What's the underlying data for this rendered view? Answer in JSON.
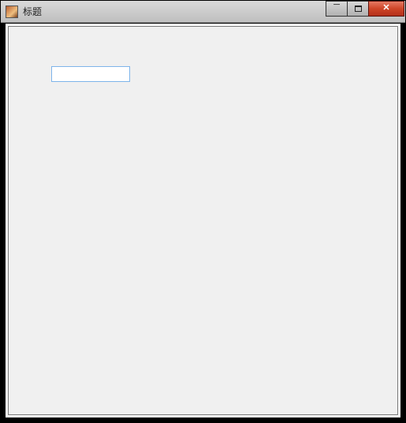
{
  "window": {
    "title": "标题"
  },
  "input": {
    "value": "",
    "placeholder": ""
  },
  "icons": {
    "minimize": "minimize-icon",
    "maximize": "maximize-icon",
    "close": "close-icon",
    "app": "app-icon"
  }
}
